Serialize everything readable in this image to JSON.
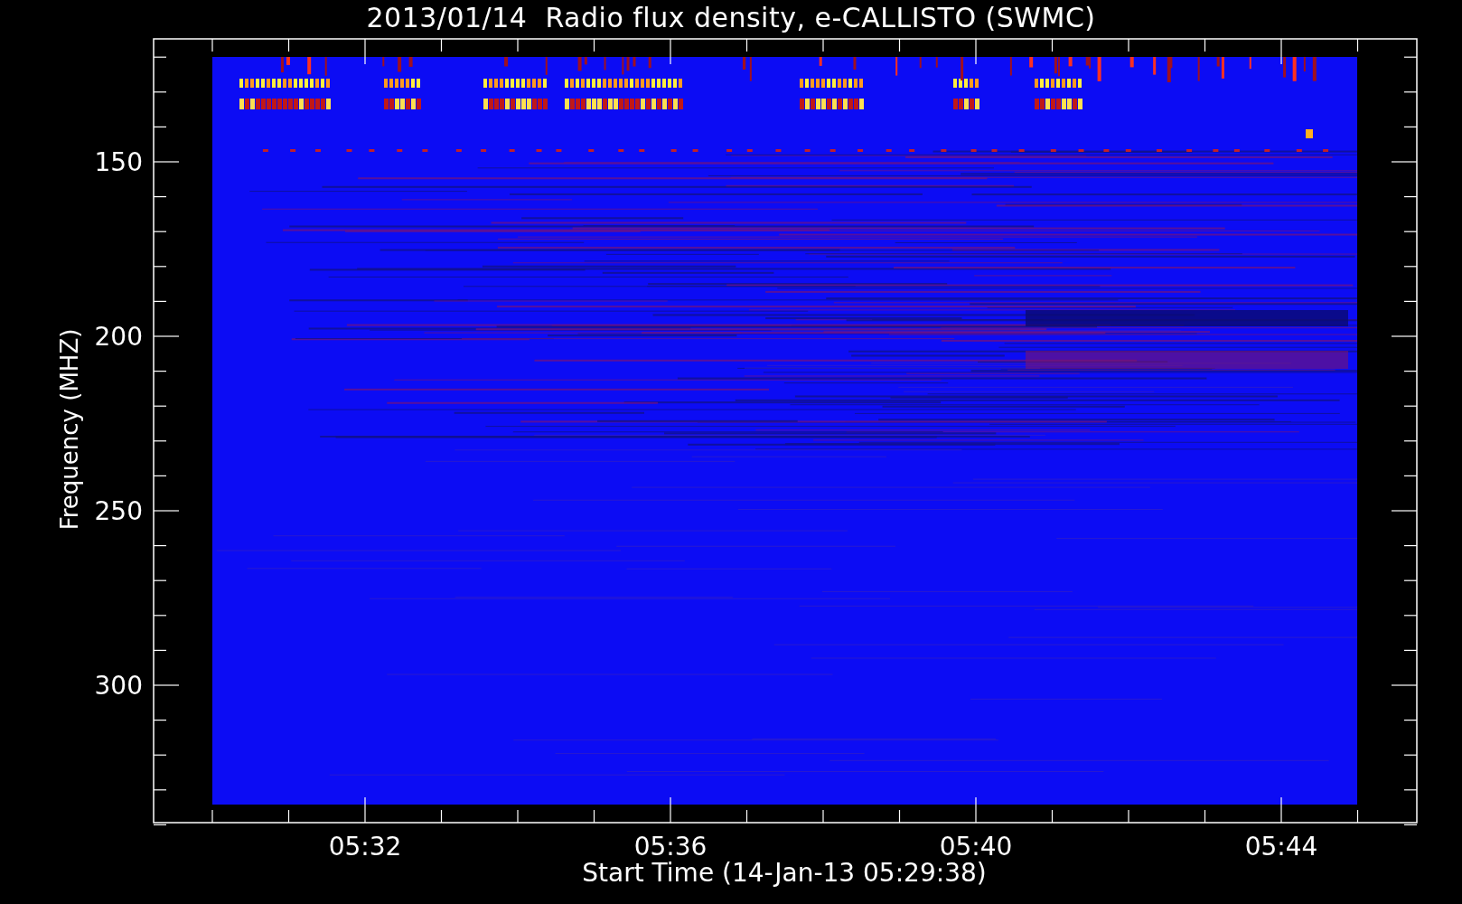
{
  "title": "2013/01/14  Radio flux density, e-CALLISTO (SWMC)",
  "y_axis": {
    "label": "Frequency (MHZ)",
    "ticks": [
      "150",
      "200",
      "250",
      "300"
    ]
  },
  "x_axis": {
    "label": "Start Time (14-Jan-13 05:29:38)",
    "ticks": [
      "05:32",
      "05:36",
      "05:40",
      "05:44"
    ]
  }
}
